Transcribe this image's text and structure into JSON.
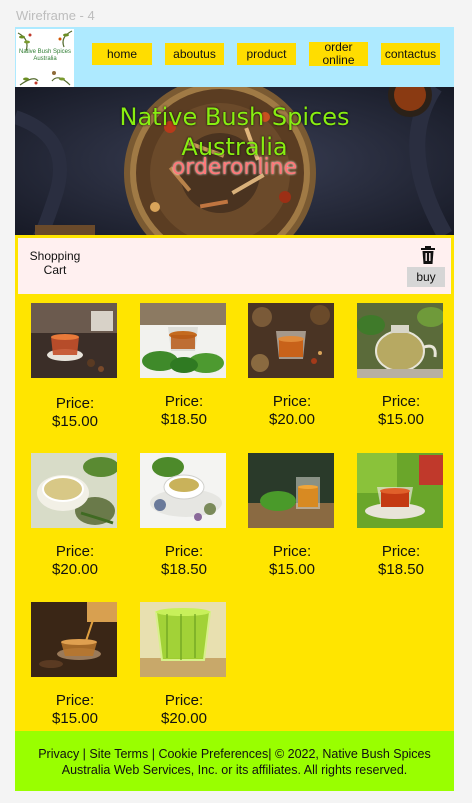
{
  "frame": {
    "label": "Wireframe - 4"
  },
  "logo": {
    "line1": "Native Bush Spices",
    "line2": "Australia"
  },
  "nav": [
    {
      "label": "home"
    },
    {
      "label": "aboutus"
    },
    {
      "label": "product"
    },
    {
      "label": "order online"
    },
    {
      "label": "contactus"
    }
  ],
  "hero": {
    "title_line1": "Native Bush Spices",
    "title_line2": "Australia",
    "subtitle": "orderonline"
  },
  "cart": {
    "label": "Shopping Cart",
    "buy_label": "buy"
  },
  "products": [
    {
      "price_label": "Price:",
      "price": "$15.00",
      "image": "tea-cup-spices"
    },
    {
      "price_label": "Price:",
      "price": "$18.50",
      "image": "tea-cup-leaves"
    },
    {
      "price_label": "Price:",
      "price": "$20.00",
      "image": "tea-spices-table"
    },
    {
      "price_label": "Price:",
      "price": "$15.00",
      "image": "glass-teapot"
    },
    {
      "price_label": "Price:",
      "price": "$20.00",
      "image": "green-tea-herbs"
    },
    {
      "price_label": "Price:",
      "price": "$18.50",
      "image": "herbal-tea-saucer"
    },
    {
      "price_label": "Price:",
      "price": "$15.00",
      "image": "tea-glass-wood"
    },
    {
      "price_label": "Price:",
      "price": "$18.50",
      "image": "red-tea-cup"
    },
    {
      "price_label": "Price:",
      "price": "$15.00",
      "image": "pouring-tea"
    },
    {
      "price_label": "Price:",
      "price": "$20.00",
      "image": "green-glass-cup"
    }
  ],
  "footer": {
    "privacy": "Privacy",
    "sep1": " | ",
    "site_terms": "Site Terms",
    "sep2": " | ",
    "cookie": "Cookie Preferences",
    "copyright": "| ©  2022, Native Bush Spices Australia Web Services, Inc. or its affiliates. All rights reserved."
  },
  "colors": {
    "frame_bg": "#ffe500",
    "header_bg": "#aeeaff",
    "nav_btn": "#ffdd00",
    "footer_bg": "#99ff00",
    "hero_title": "#88ee11",
    "hero_subtitle": "#ff7777",
    "cart_bg": "#fff0f0"
  }
}
